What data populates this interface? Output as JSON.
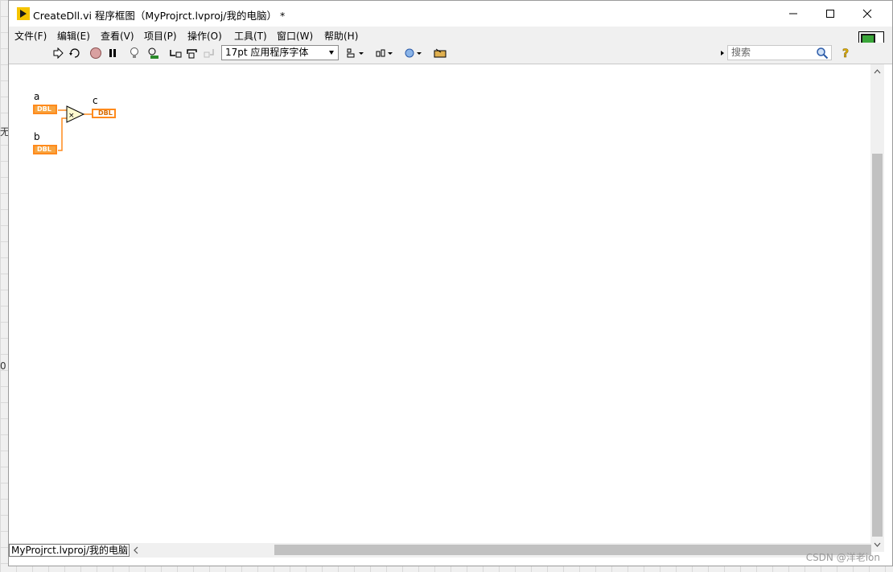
{
  "window": {
    "title": "CreateDll.vi 程序框图（MyProjrct.lvproj/我的电脑） *"
  },
  "background_fragments": [
    "无",
    "0"
  ],
  "menu": [
    "文件(F)",
    "编辑(E)",
    "查看(V)",
    "项目(P)",
    "操作(O)",
    "工具(T)",
    "窗口(W)",
    "帮助(H)"
  ],
  "toolbar": {
    "font_select": "17pt 应用程序字体",
    "search_placeholder": "搜索"
  },
  "diagram": {
    "inputs": [
      {
        "label": "a",
        "type": "DBL"
      },
      {
        "label": "b",
        "type": "DBL"
      }
    ],
    "operator": "×",
    "output": {
      "label": "c",
      "type": "DBL"
    }
  },
  "vi_icon_connector": "2",
  "status": {
    "project_path": "MyProjrct.lvproj/我的电脑"
  },
  "watermark": "CSDN @洋老ion"
}
